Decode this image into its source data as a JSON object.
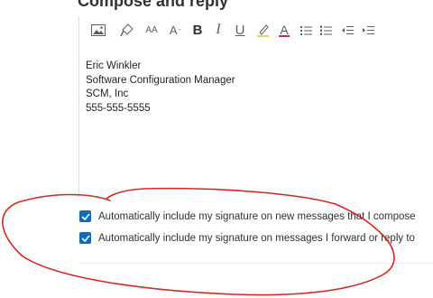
{
  "section": {
    "title": "Compose and reply"
  },
  "toolbar": {
    "tools": [
      {
        "name": "insert-picture-icon"
      },
      {
        "name": "format-painter-icon"
      },
      {
        "name": "font-size-icon",
        "glyph": "AA"
      },
      {
        "name": "grow-font-icon",
        "glyph": "A"
      },
      {
        "name": "bold-icon",
        "glyph": "B"
      },
      {
        "name": "italic-icon",
        "glyph": "I"
      },
      {
        "name": "underline-icon",
        "glyph": "U"
      },
      {
        "name": "highlight-icon"
      },
      {
        "name": "font-color-icon",
        "glyph": "A"
      },
      {
        "name": "bullets-icon"
      },
      {
        "name": "numbering-icon"
      },
      {
        "name": "decrease-indent-icon"
      },
      {
        "name": "increase-indent-icon"
      }
    ]
  },
  "signature": {
    "lines": [
      "Eric Winkler",
      "Software Configuration Manager",
      "SCM, Inc",
      "555-555-5555"
    ]
  },
  "options": [
    {
      "label": "Automatically include my signature on new messages that I compose",
      "checked": true
    },
    {
      "label": "Automatically include my signature on messages I forward or reply to",
      "checked": true
    }
  ],
  "colors": {
    "checkbox": "#0f6cbd",
    "annotation": "#d9261c"
  }
}
